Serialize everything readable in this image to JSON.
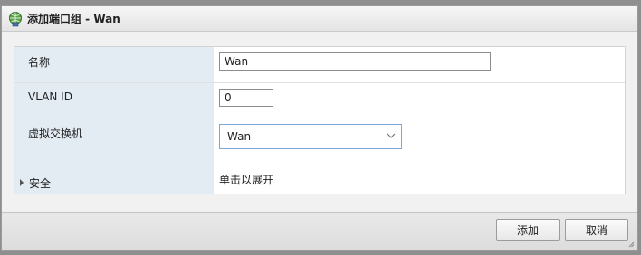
{
  "window": {
    "title": "添加端口组 - Wan",
    "icon": "network-portgroup-icon"
  },
  "form": {
    "name": {
      "label": "名称",
      "value": "Wan"
    },
    "vlan": {
      "label": "VLAN ID",
      "value": "0"
    },
    "vswitch": {
      "label": "虚拟交换机",
      "value": "Wan"
    },
    "security": {
      "label": "安全",
      "text": "单击以展开"
    }
  },
  "buttons": {
    "add": "添加",
    "cancel": "取消"
  }
}
